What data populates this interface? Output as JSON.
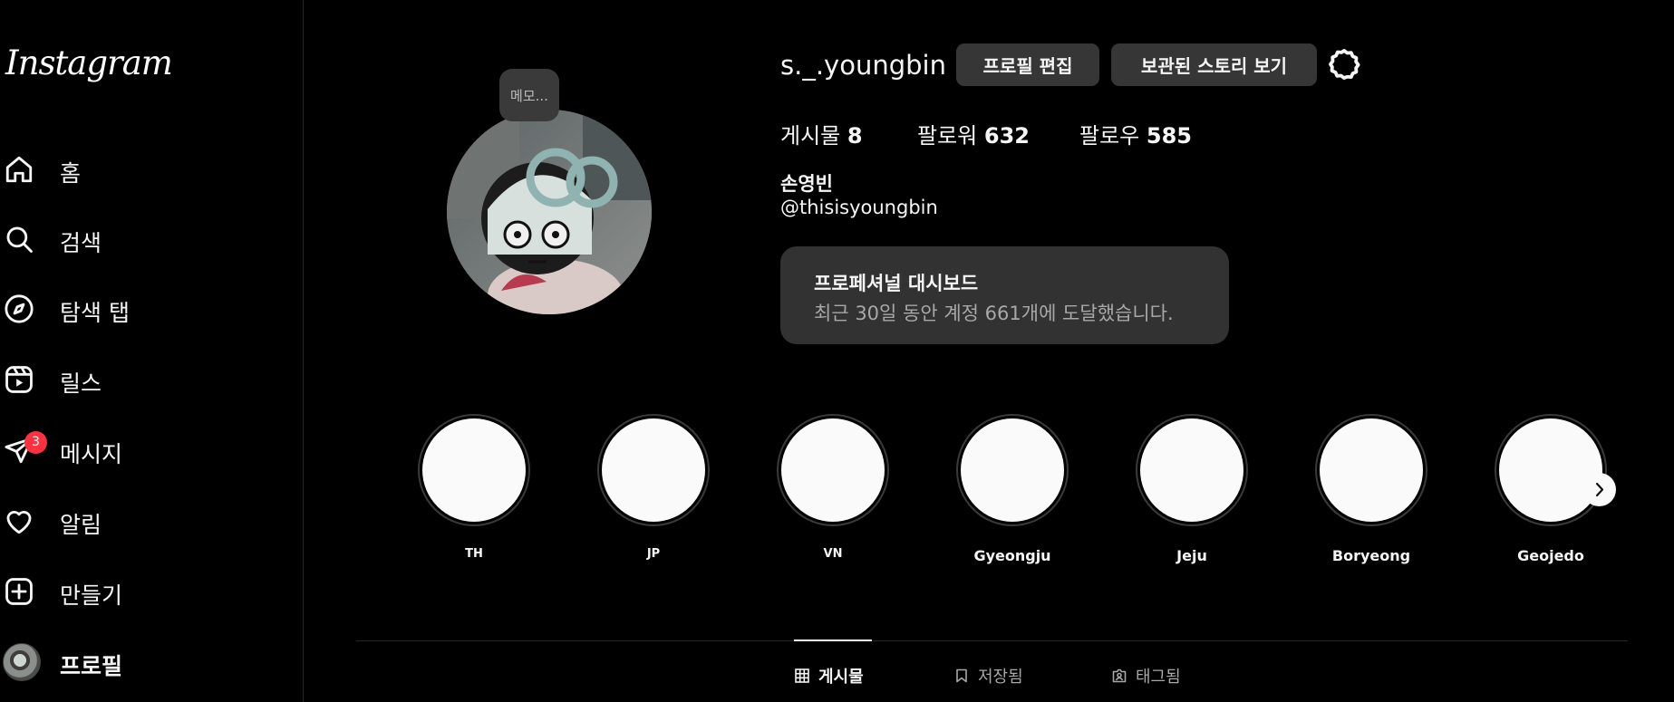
{
  "brand": {
    "logo_text": "Instagram"
  },
  "sidebar": {
    "items": [
      {
        "label": "홈",
        "icon": "home-icon"
      },
      {
        "label": "검색",
        "icon": "search-icon"
      },
      {
        "label": "탐색 탭",
        "icon": "compass-icon"
      },
      {
        "label": "릴스",
        "icon": "reels-icon"
      },
      {
        "label": "메시지",
        "icon": "send-icon",
        "badge": "3"
      },
      {
        "label": "알림",
        "icon": "heart-icon"
      },
      {
        "label": "만들기",
        "icon": "plus-square-icon"
      },
      {
        "label": "프로필",
        "icon": "avatar",
        "active": true
      }
    ]
  },
  "profile": {
    "memo": "메모...",
    "username": "s._.youngbin",
    "edit_button": "프로필 편집",
    "archive_button": "보관된 스토리 보기",
    "stats": {
      "posts_label": "게시물",
      "posts": "8",
      "followers_label": "팔로워",
      "followers": "632",
      "following_label": "팔로우",
      "following": "585"
    },
    "full_name": "손영빈",
    "handle": "@thisisyoungbin",
    "dashboard": {
      "title": "프로페셔널 대시보드",
      "subtitle": "최근 30일 동안 계정 661개에 도달했습니다."
    }
  },
  "highlights": [
    {
      "label": "TH"
    },
    {
      "label": "JP"
    },
    {
      "label": "VN"
    },
    {
      "label": "Gyeongju"
    },
    {
      "label": "Jeju"
    },
    {
      "label": "Boryeong"
    },
    {
      "label": "Geojedo"
    }
  ],
  "tabs": [
    {
      "label": "게시물",
      "icon": "grid-icon",
      "active": true
    },
    {
      "label": "저장됨",
      "icon": "bookmark-icon",
      "active": false
    },
    {
      "label": "태그됨",
      "icon": "tag-person-icon",
      "active": false
    }
  ],
  "colors": {
    "badge": "#ff3040",
    "button_bg": "#363636",
    "dashboard_bg": "#323232"
  }
}
